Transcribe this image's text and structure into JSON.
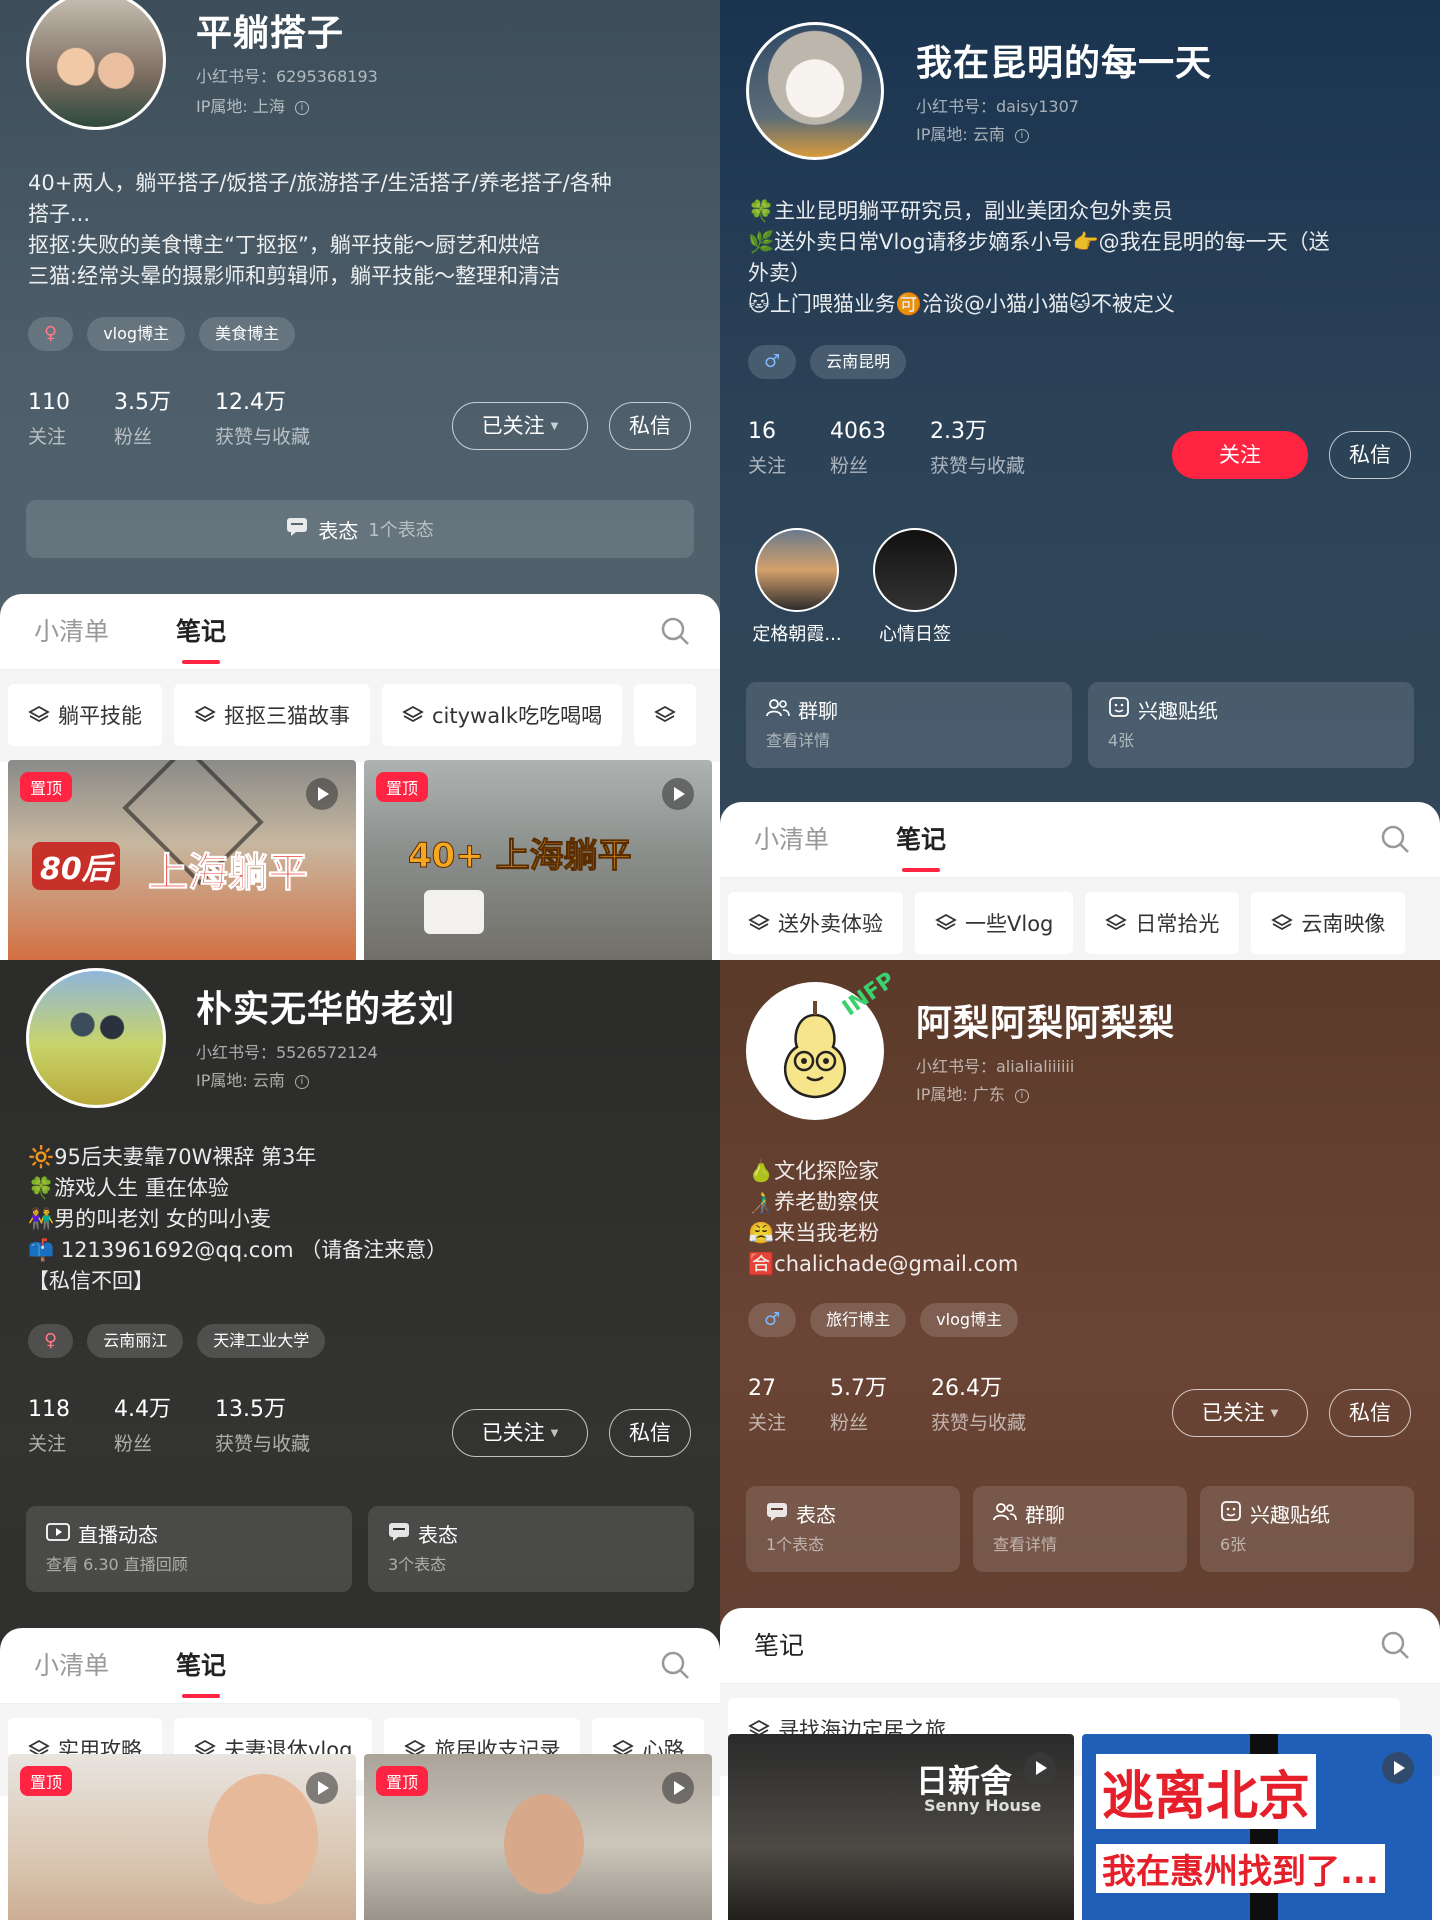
{
  "panels": {
    "p1": {
      "name": "平躺搭子",
      "rednote_id": "小红书号：6295368193",
      "ip": "IP属地: 上海",
      "bio": [
        "40+两人，躺平搭子/饭搭子/旅游搭子/生活搭子/养老搭子/各种",
        "搭子...",
        "抠抠:失败的美食博主“丁抠抠”，躺平技能～厨艺和烘焙",
        "三猫:经常头晕的摄影师和剪辑师，躺平技能～整理和清洁"
      ],
      "gender": "♀",
      "tags": [
        "vlog博主",
        "美食博主"
      ],
      "stats": [
        {
          "n": "110",
          "l": "关注"
        },
        {
          "n": "3.5万",
          "l": "粉丝"
        },
        {
          "n": "12.4万",
          "l": "获赞与收藏"
        }
      ],
      "follow_btn": "已关注",
      "msg_btn": "私信",
      "status_bar": {
        "label": "表态",
        "sub": "1个表态"
      },
      "tabs": [
        "小清单",
        "笔记"
      ],
      "chips": [
        "躺平技能",
        "抠抠三猫故事",
        "citywalk吃吃喝喝"
      ],
      "thumbs": [
        {
          "pin": "置顶",
          "title_a": "80后",
          "title_b": "上海躺平"
        },
        {
          "pin": "置顶",
          "title": "40+ 上海躺平"
        }
      ]
    },
    "p2": {
      "name": "我在昆明的每一天",
      "rednote_id": "小红书号：daisy1307",
      "ip": "IP属地: 云南",
      "bio": [
        "🍀主业昆明躺平研究员，副业美团众包外卖员",
        "🌿送外卖日常Vlog请移步嫡系小号👉@我在昆明的每一天（送",
        "外卖）",
        "🐱上门喂猫业务🉑洽谈@小猫小猫🐱不被定义"
      ],
      "gender": "♂",
      "tags": [
        "云南昆明"
      ],
      "stats": [
        {
          "n": "16",
          "l": "关注"
        },
        {
          "n": "4063",
          "l": "粉丝"
        },
        {
          "n": "2.3万",
          "l": "获赞与收藏"
        }
      ],
      "follow_btn": "关注",
      "msg_btn": "私信",
      "highlights": [
        "定格朝霞...",
        "心情日签"
      ],
      "cards": [
        {
          "t": "群聊",
          "s": "查看详情"
        },
        {
          "t": "兴趣贴纸",
          "s": "4张"
        }
      ],
      "tabs": [
        "小清单",
        "笔记"
      ],
      "chips": [
        "送外卖体验",
        "一些Vlog",
        "日常拾光",
        "云南映像"
      ]
    },
    "p3": {
      "name": "朴实无华的老刘",
      "rednote_id": "小红书号：5526572124",
      "ip": "IP属地: 云南",
      "bio": [
        "🔆95后夫妻靠70W裸辞 第3年",
        "🍀游戏人生 重在体验",
        "👫男的叫老刘  女的叫小麦",
        "📫 1213961692@qq.com （请备注来意）",
        "【私信不回】"
      ],
      "gender": "♀",
      "tags": [
        "云南丽江",
        "天津工业大学"
      ],
      "stats": [
        {
          "n": "118",
          "l": "关注"
        },
        {
          "n": "4.4万",
          "l": "粉丝"
        },
        {
          "n": "13.5万",
          "l": "获赞与收藏"
        }
      ],
      "follow_btn": "已关注",
      "msg_btn": "私信",
      "cards": [
        {
          "t": "直播动态",
          "s": "查看 6.30 直播回顾"
        },
        {
          "t": "表态",
          "s": "3个表态"
        }
      ],
      "tabs": [
        "小清单",
        "笔记"
      ],
      "chips": [
        "实用攻略",
        "夫妻退休vlog",
        "旅居收支记录",
        "心路"
      ],
      "thumbs": [
        {
          "pin": "置顶"
        },
        {
          "pin": "置顶"
        }
      ]
    },
    "p4": {
      "name": "阿梨阿梨阿梨梨",
      "rednote_id": "小红书号：alialialiiiiii",
      "ip": "IP属地: 广东",
      "badge": "INFP",
      "bio": [
        "🍐文化探险家",
        "👨‍🦯养老勘察侠",
        "😤来当我老粉",
        "🈴chalichade@gmail.com"
      ],
      "gender": "♂",
      "tags": [
        "旅行博主",
        "vlog博主"
      ],
      "stats": [
        {
          "n": "27",
          "l": "关注"
        },
        {
          "n": "5.7万",
          "l": "粉丝"
        },
        {
          "n": "26.4万",
          "l": "获赞与收藏"
        }
      ],
      "follow_btn": "已关注",
      "msg_btn": "私信",
      "cards": [
        {
          "t": "表态",
          "s": "1个表态"
        },
        {
          "t": "群聊",
          "s": "查看详情"
        },
        {
          "t": "兴趣贴纸",
          "s": "6张"
        }
      ],
      "tabs": [
        "笔记"
      ],
      "chips": [
        "寻找海边定居之旅"
      ],
      "thumbs": [
        {
          "title": "日新舍",
          "sub": "Senny House"
        },
        {
          "title": "逃离北京",
          "sub": "我在惠州找到了..."
        }
      ]
    }
  },
  "colors": {
    "accent": "#ff2442"
  }
}
